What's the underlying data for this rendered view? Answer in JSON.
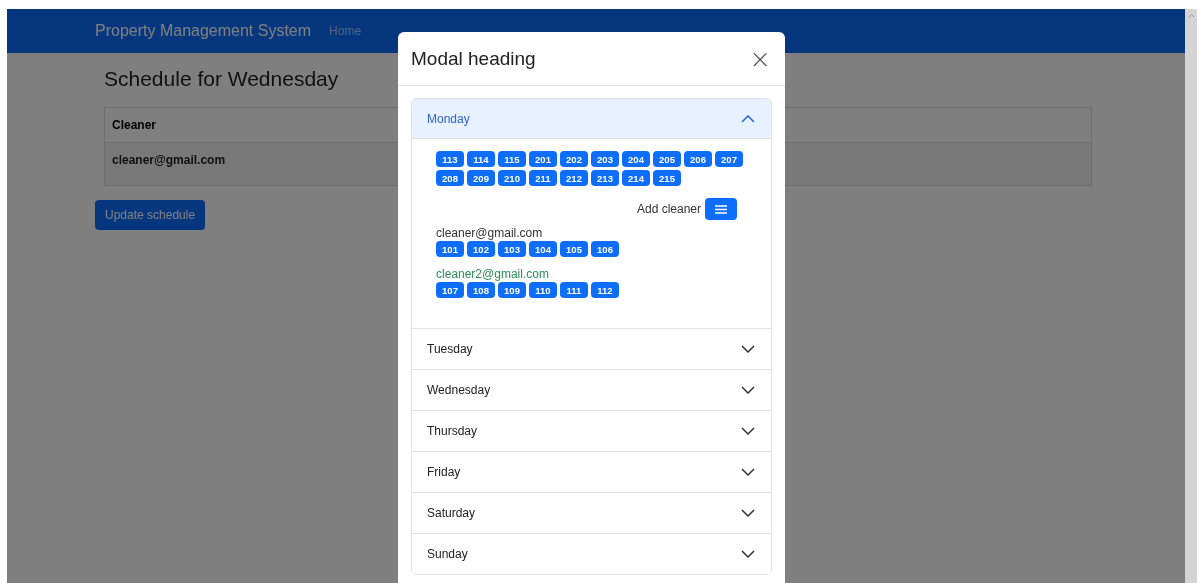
{
  "navbar": {
    "brand": "Property Management System",
    "links": [
      "Home"
    ]
  },
  "page": {
    "title": "Schedule for Wednesday",
    "table": {
      "columns": [
        "Cleaner"
      ],
      "rows": [
        [
          "cleaner@gmail.com"
        ]
      ]
    },
    "update_button": "Update schedule"
  },
  "modal": {
    "title": "Modal heading",
    "close": "×",
    "accordion": [
      {
        "label": "Monday",
        "expanded": true,
        "rooms": [
          "113",
          "114",
          "115",
          "201",
          "202",
          "203",
          "204",
          "205",
          "206",
          "207",
          "208",
          "209",
          "210",
          "211",
          "212",
          "213",
          "214",
          "215"
        ],
        "add_label": "Add cleaner",
        "cleaners": [
          {
            "email": "cleaner@gmail.com",
            "color": "#333333",
            "rooms": [
              "101",
              "102",
              "103",
              "104",
              "105",
              "106"
            ]
          },
          {
            "email": "cleaner2@gmail.com",
            "color": "#2e8b57",
            "rooms": [
              "107",
              "108",
              "109",
              "110",
              "111",
              "112"
            ]
          }
        ]
      },
      {
        "label": "Tuesday",
        "expanded": false
      },
      {
        "label": "Wednesday",
        "expanded": false
      },
      {
        "label": "Thursday",
        "expanded": false
      },
      {
        "label": "Friday",
        "expanded": false
      },
      {
        "label": "Saturday",
        "expanded": false
      },
      {
        "label": "Sunday",
        "expanded": false
      }
    ]
  }
}
